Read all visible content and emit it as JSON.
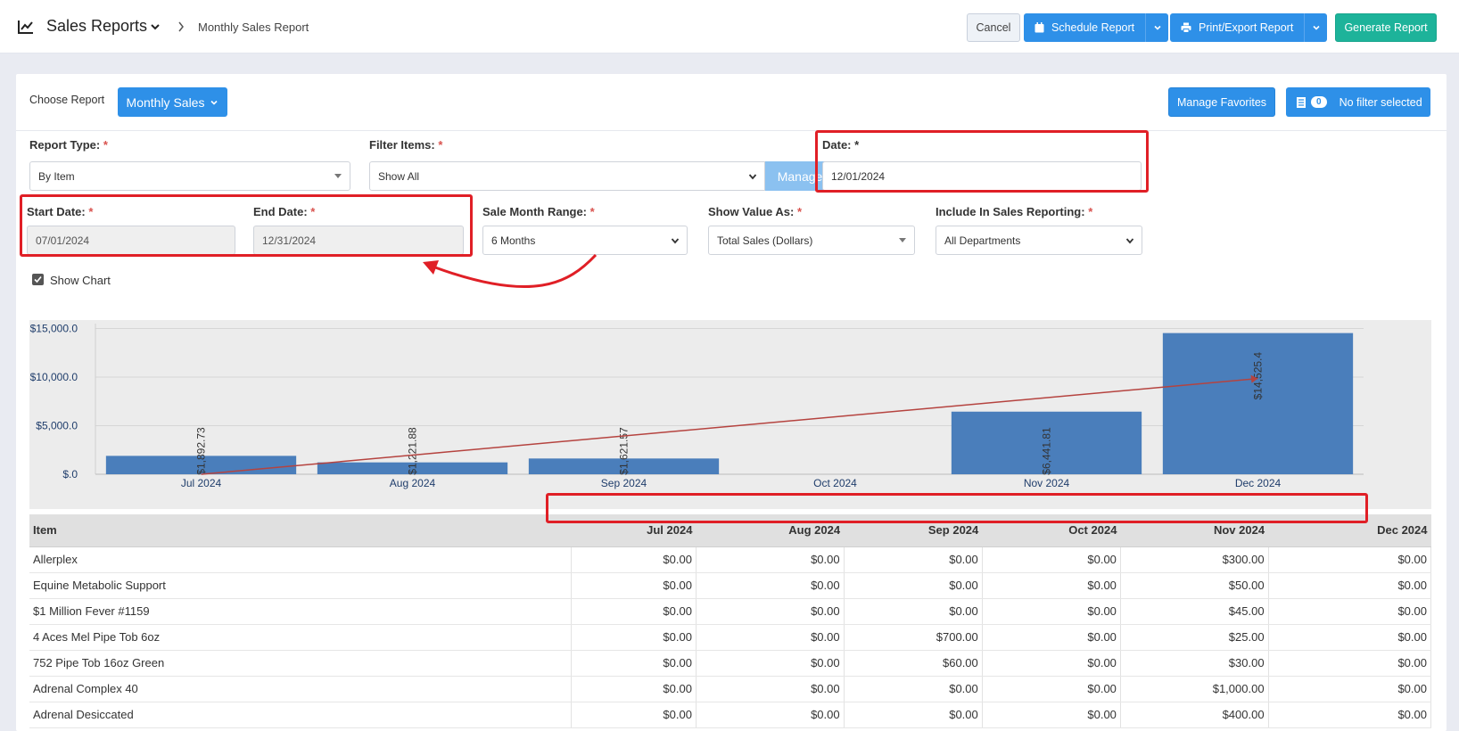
{
  "header": {
    "title": "Sales Reports",
    "breadcrumb": "Monthly Sales Report",
    "cancel_label": "Cancel",
    "schedule_label": "Schedule Report",
    "print_label": "Print/Export Report",
    "generate_label": "Generate Report"
  },
  "toolbar": {
    "choose_report_label": "Choose Report",
    "report_selected": "Monthly Sales",
    "manage_favorites_label": "Manage Favorites",
    "filter_count": "0",
    "filter_label": "No filter selected"
  },
  "form": {
    "report_type_label": "Report Type:",
    "report_type_value": "By Item",
    "filter_items_label": "Filter Items:",
    "filter_items_value": "Show All",
    "manage_label": "Manage",
    "date_label": "Date:",
    "date_value": "12/01/2024",
    "start_date_label": "Start Date:",
    "start_date_value": "07/01/2024",
    "end_date_label": "End Date:",
    "end_date_value": "12/31/2024",
    "sale_month_range_label": "Sale Month Range:",
    "sale_month_range_value": "6 Months",
    "show_value_as_label": "Show Value As:",
    "show_value_as_value": "Total Sales (Dollars)",
    "include_label": "Include In Sales Reporting:",
    "include_value": "All Departments",
    "required_mark": "*",
    "show_chart_label": "Show Chart"
  },
  "chart_data": {
    "type": "bar",
    "categories": [
      "Jul 2024",
      "Aug 2024",
      "Sep 2024",
      "Oct 2024",
      "Nov 2024",
      "Dec 2024"
    ],
    "values": [
      1892.73,
      1221.88,
      1621.57,
      0,
      6441.81,
      14525.4
    ],
    "value_labels": [
      "$1,892.73",
      "$1,221.88",
      "$1,621.57",
      "",
      "$6,441.81",
      "$14,525.4"
    ],
    "y_ticks": [
      0,
      5000,
      10000,
      15000
    ],
    "y_tick_labels": [
      "$.0",
      "$5,000.0",
      "$10,000.0",
      "$15,000.0"
    ],
    "ylim": [
      0,
      15500
    ],
    "trendline": {
      "start": 0,
      "end": 9850
    },
    "bar_color": "#4a7ebb",
    "trend_color": "#b5433f",
    "grid": true
  },
  "table": {
    "item_header": "Item",
    "month_headers": [
      "Jul 2024",
      "Aug 2024",
      "Sep 2024",
      "Oct 2024",
      "Nov 2024",
      "Dec 2024"
    ],
    "rows": [
      {
        "item": "Allerplex",
        "values": [
          "$0.00",
          "$0.00",
          "$0.00",
          "$0.00",
          "$300.00",
          "$0.00"
        ]
      },
      {
        "item": "Equine Metabolic Support",
        "values": [
          "$0.00",
          "$0.00",
          "$0.00",
          "$0.00",
          "$50.00",
          "$0.00"
        ]
      },
      {
        "item": "$1 Million Fever #1159",
        "values": [
          "$0.00",
          "$0.00",
          "$0.00",
          "$0.00",
          "$45.00",
          "$0.00"
        ]
      },
      {
        "item": "4 Aces Mel Pipe Tob 6oz",
        "values": [
          "$0.00",
          "$0.00",
          "$700.00",
          "$0.00",
          "$25.00",
          "$0.00"
        ]
      },
      {
        "item": "752 Pipe Tob 16oz Green",
        "values": [
          "$0.00",
          "$0.00",
          "$60.00",
          "$0.00",
          "$30.00",
          "$0.00"
        ]
      },
      {
        "item": "Adrenal Complex 40",
        "values": [
          "$0.00",
          "$0.00",
          "$0.00",
          "$0.00",
          "$1,000.00",
          "$0.00"
        ]
      },
      {
        "item": "Adrenal Desiccated",
        "values": [
          "$0.00",
          "$0.00",
          "$0.00",
          "$0.00",
          "$400.00",
          "$0.00"
        ]
      }
    ]
  },
  "colors": {
    "primary": "#2e90e8",
    "teal": "#1db39a",
    "highlight": "#e01f26",
    "required": "#d9534f"
  }
}
